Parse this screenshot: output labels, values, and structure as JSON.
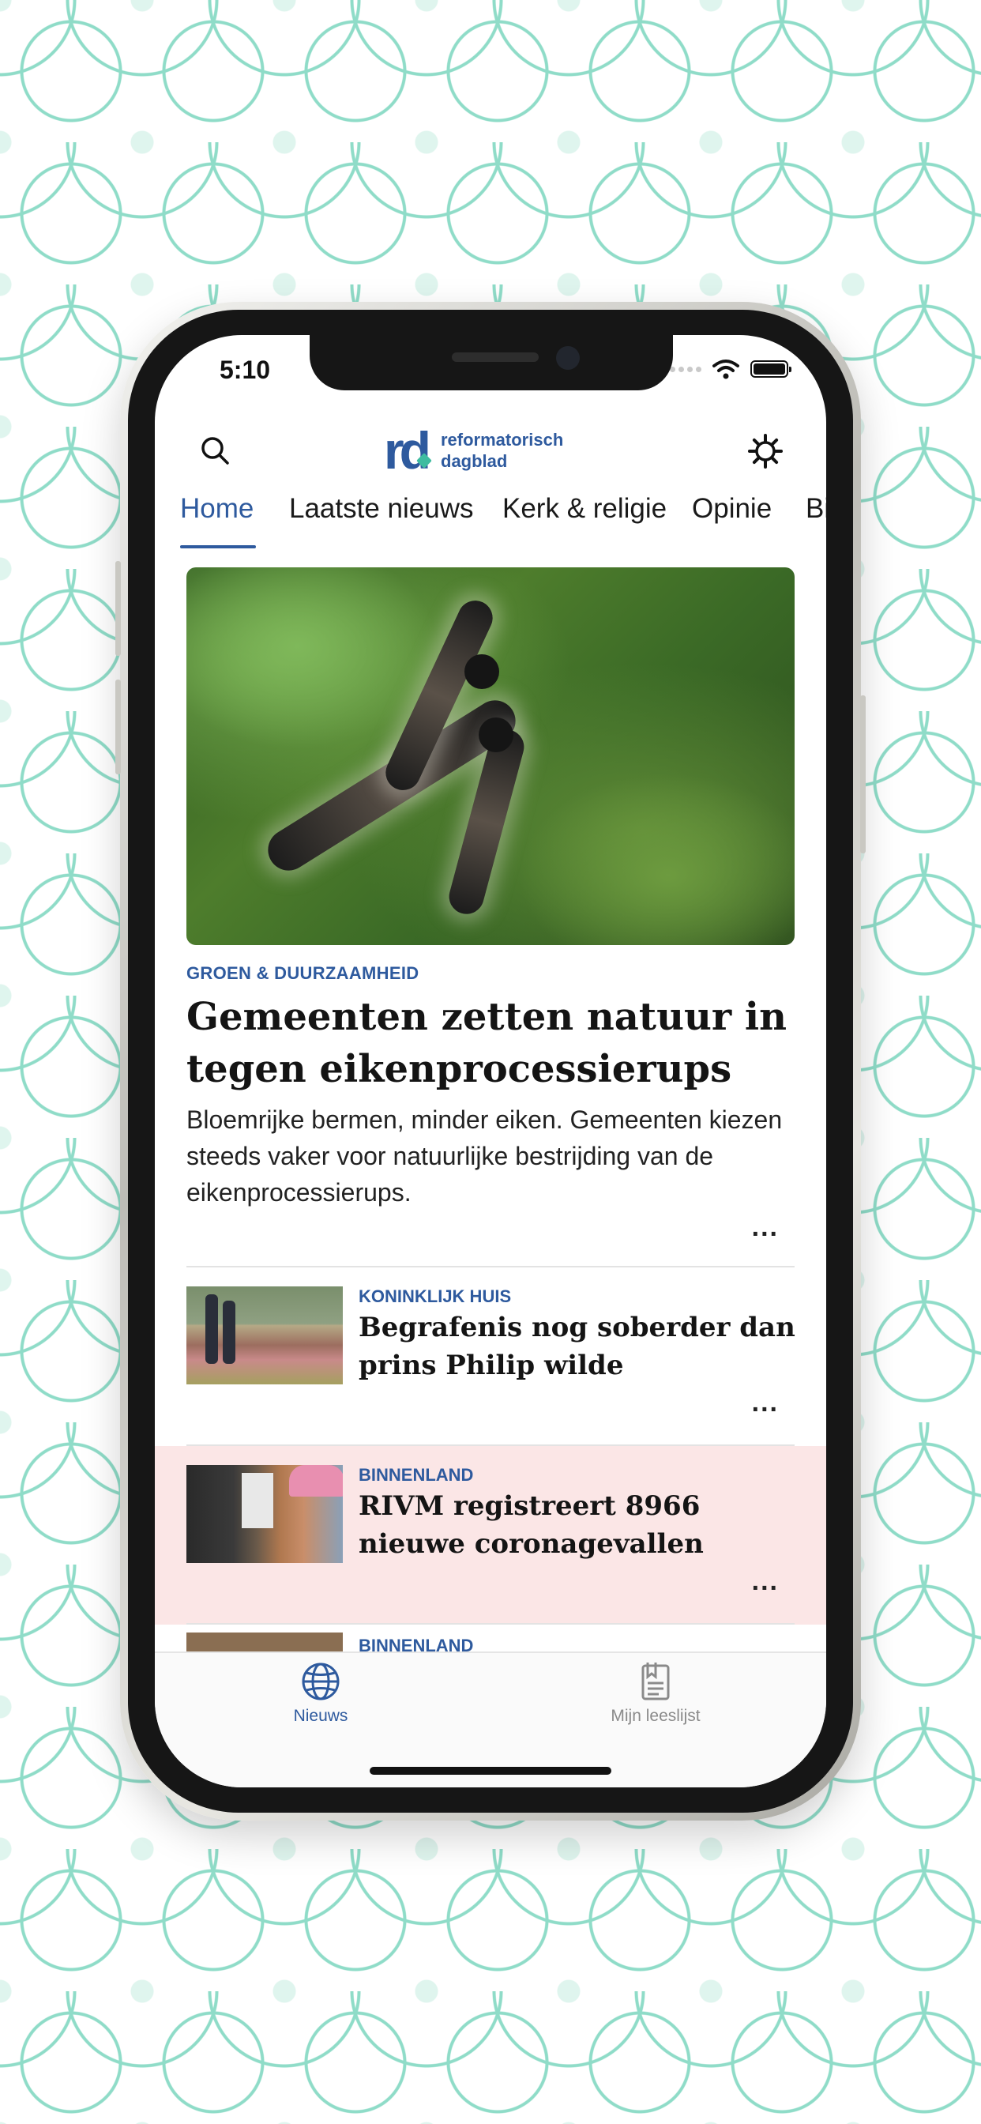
{
  "status_bar": {
    "time": "5:10"
  },
  "header": {
    "logo_mark": "rd",
    "logo_line1": "reformatorisch",
    "logo_line2": "dagblad",
    "search_icon": "search-icon",
    "settings_icon": "gear-icon"
  },
  "tabs": [
    {
      "label": "Home",
      "active": true
    },
    {
      "label": "Laatste nieuws",
      "active": false
    },
    {
      "label": "Kerk & religie",
      "active": false
    },
    {
      "label": "Opinie",
      "active": false
    },
    {
      "label": "Bi",
      "active": false
    }
  ],
  "hero": {
    "category": "GROEN & DUURZAAMHEID",
    "title": "Gemeenten zetten natuur in tegen eikenprocessierups",
    "summary": "Bloemrijke bermen, minder eiken. Gemeenten kiezen steeds vaker voor natuurlijke bestrijding van de eikenprocessierups.",
    "more": "..."
  },
  "articles": [
    {
      "category": "KONINKLIJK HUIS",
      "title": "Begrafenis nog soberder dan prins Philip wilde",
      "more": "...",
      "highlighted": false
    },
    {
      "category": "BINNENLAND",
      "title": "RIVM registreert 8966 nieuwe coronagevallen",
      "more": "...",
      "highlighted": true
    },
    {
      "category": "BINNENLAND",
      "title": "",
      "more": "",
      "highlighted": false
    }
  ],
  "tabbar": {
    "items": [
      {
        "label": "Nieuws",
        "icon": "globe-icon",
        "active": true
      },
      {
        "label": "Mijn leeslijst",
        "icon": "reading-list-icon",
        "active": false
      }
    ]
  },
  "colors": {
    "accent": "#2e5a9e",
    "logo_accent": "#3fbca0",
    "highlight_row": "#fbe6e6",
    "inactive_tab": "#8a8a8a"
  }
}
